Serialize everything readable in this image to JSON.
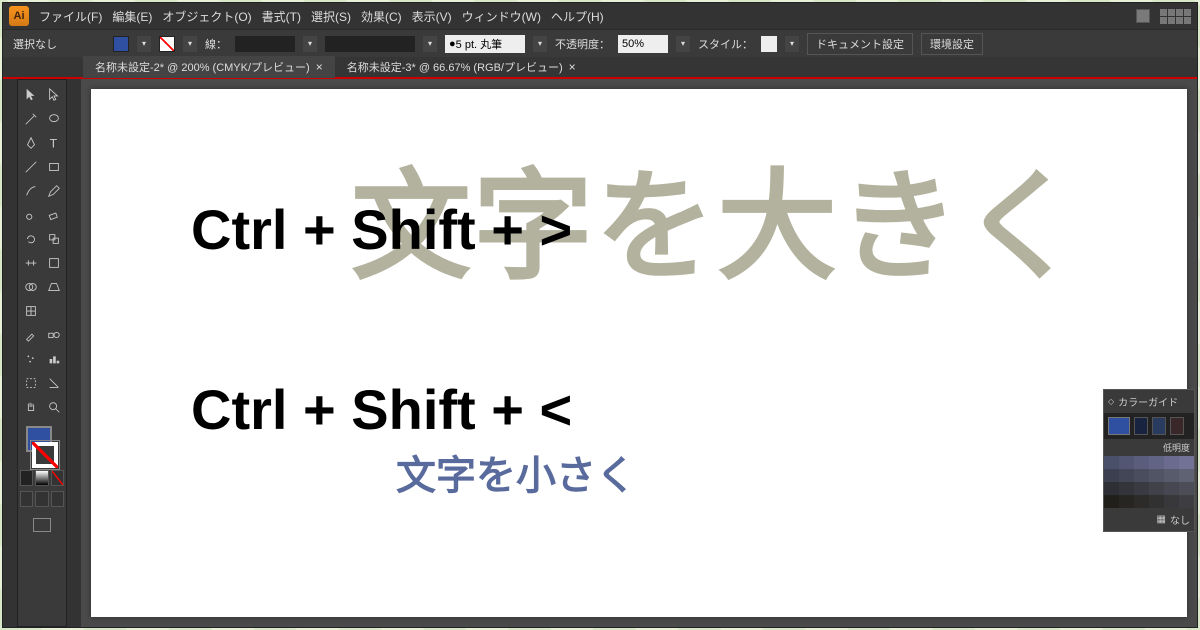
{
  "menubar": {
    "items": [
      "ファイル(F)",
      "編集(E)",
      "オブジェクト(O)",
      "書式(T)",
      "選択(S)",
      "効果(C)",
      "表示(V)",
      "ウィンドウ(W)",
      "ヘルプ(H)"
    ]
  },
  "controlbar": {
    "selection_label": "選択なし",
    "fill_color": "#2f4fa0",
    "stroke_label": "線：",
    "preset_value": "5 pt. 丸筆",
    "opacity_label": "不透明度：",
    "opacity_value": "50%",
    "style_label": "スタイル：",
    "doc_setup_label": "ドキュメント設定",
    "prefs_label": "環境設定"
  },
  "tabs": [
    {
      "label": "名称未設定-2* @ 200% (CMYK/プレビュー)",
      "active": true
    },
    {
      "label": "名称未設定-3* @ 66.67% (RGB/プレビュー)",
      "active": false
    }
  ],
  "canvas": {
    "overlay_big": "文字を大きく",
    "shortcut1": "Ctrl + Shift + >",
    "shortcut2": "Ctrl + Shift + <",
    "overlay_small": "文字を小さく"
  },
  "color_guide": {
    "title": "カラーガイド",
    "brightness_label": "低明度",
    "none_label": "なし",
    "grid": [
      "#4a4f6a",
      "#525673",
      "#5a5d7c",
      "#626485",
      "#6a6b8e",
      "#727297",
      "#3c3f4f",
      "#434656",
      "#4a4d5d",
      "#515464",
      "#585b6b",
      "#5f6272",
      "#2e2f34",
      "#34353b",
      "#3a3b42",
      "#404149",
      "#464750",
      "#4c4d57",
      "#201f19",
      "#262521",
      "#2c2b29",
      "#323131",
      "#383739",
      "#3e3d41"
    ]
  },
  "brand": {
    "logo_text": "Ai"
  }
}
